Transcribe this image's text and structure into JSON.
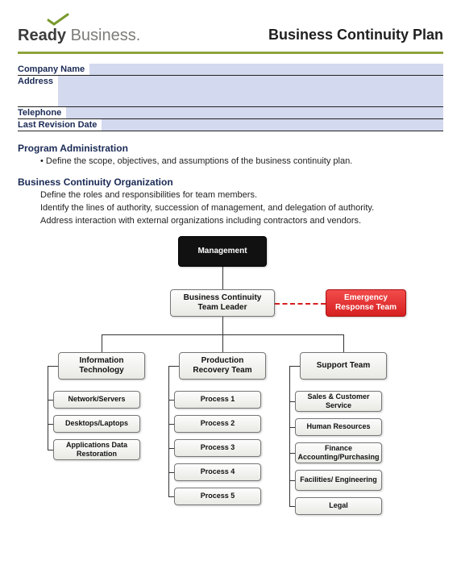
{
  "brand": {
    "strong": "Ready",
    "light": "Business."
  },
  "title": "Business Continuity Plan",
  "form": {
    "company_label": "Company Name",
    "address_label": "Address",
    "telephone_label": "Telephone",
    "revision_label": "Last Revision Date"
  },
  "sections": {
    "admin_heading": "Program Administration",
    "admin_bullet": "Define the scope, objectives, and assumptions of the business continuity plan.",
    "org_heading": "Business Continuity Organization",
    "org_line1": "Define the roles and responsibilities for team members.",
    "org_line2": "Identify the lines of authority, succession of management, and delegation of authority.",
    "org_line3": "Address interaction with external organizations including contractors and vendors."
  },
  "chart": {
    "management": "Management",
    "leader": "Business Continuity Team Leader",
    "emergency": "Emergency Response Team",
    "it_head": "Information Technology",
    "it_subs": [
      "Network/Servers",
      "Desktops/Laptops",
      "Applications Data Restoration"
    ],
    "prod_head": "Production Recovery Team",
    "prod_subs": [
      "Process 1",
      "Process 2",
      "Process 3",
      "Process 4",
      "Process 5"
    ],
    "supp_head": "Support Team",
    "supp_subs": [
      "Sales & Customer Service",
      "Human Resources",
      "Finance Accounting/Purchasing",
      "Facilities/ Engineering",
      "Legal"
    ]
  }
}
